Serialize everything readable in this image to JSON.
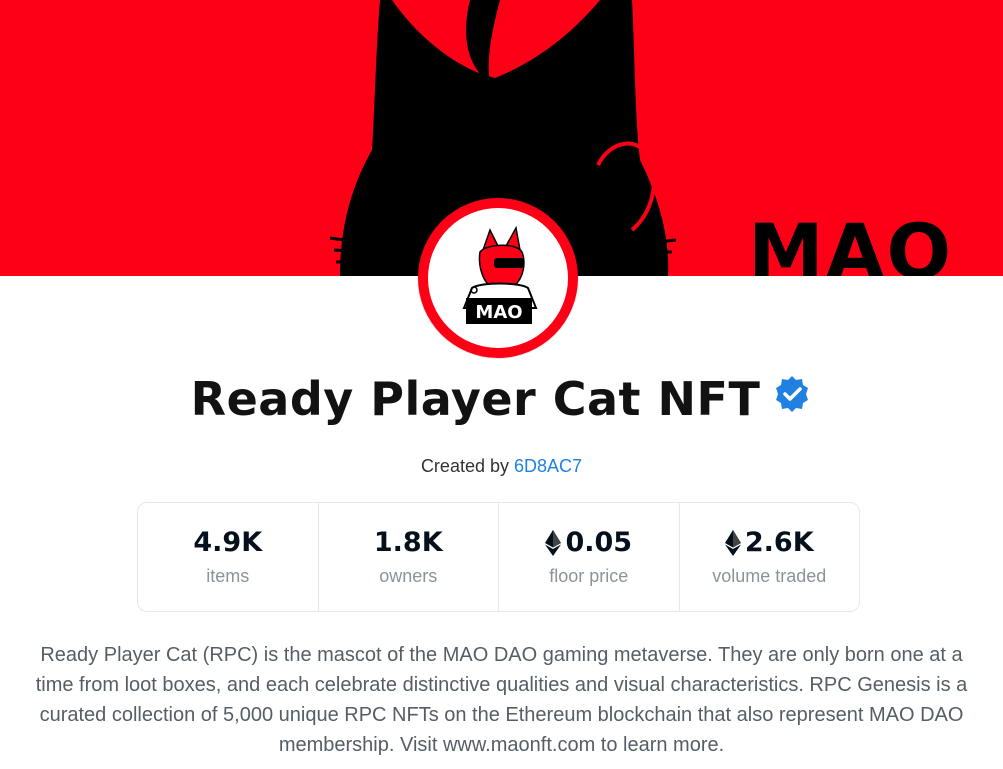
{
  "banner": {
    "text": "MAO",
    "color": "#fe0016"
  },
  "collection": {
    "title": "Ready Player Cat NFT",
    "verified_icon": "verified-badge-icon",
    "avatar_logo_text": "MAO",
    "created_by_label": "Created by",
    "creator": "6D8AC7"
  },
  "stats": [
    {
      "value": "4.9K",
      "label": "items",
      "eth": false
    },
    {
      "value": "1.8K",
      "label": "owners",
      "eth": false
    },
    {
      "value": "0.05",
      "label": "floor price",
      "eth": true
    },
    {
      "value": "2.6K",
      "label": "volume traded",
      "eth": true
    }
  ],
  "description": "Ready Player Cat (RPC) is the mascot of the MAO DAO gaming metaverse. They are only born one at a time from loot boxes, and each celebrate distinctive qualities and visual characteristics. RPC Genesis is a curated collection of 5,000 unique RPC NFTs on the Ethereum blockchain that also represent MAO DAO membership. Visit www.maonft.com to learn more.",
  "colors": {
    "accent": "#2081e2",
    "verified": "#2081e2",
    "text": "#121212"
  }
}
